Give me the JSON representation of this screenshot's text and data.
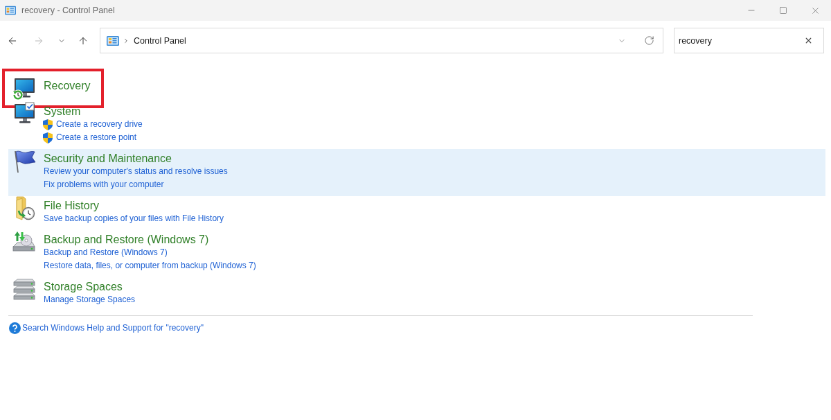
{
  "window": {
    "title": "recovery - Control Panel"
  },
  "nav_buttons": [
    {
      "kind": "back",
      "disabled": false
    },
    {
      "kind": "forward",
      "disabled": true
    },
    {
      "kind": "recent",
      "disabled": false
    },
    {
      "kind": "up",
      "disabled": false
    }
  ],
  "address_bar": {
    "path": [
      "Control Panel"
    ]
  },
  "search": {
    "value": "recovery"
  },
  "results": [
    {
      "title": "Recovery",
      "annotated": true,
      "selected": false
    },
    {
      "title": "System",
      "annotated": false,
      "selected": false,
      "links": [
        {
          "text": "Create a recovery drive",
          "admin": true
        },
        {
          "text": "Create a restore point",
          "admin": true
        }
      ]
    },
    {
      "title": "Security and Maintenance",
      "annotated": false,
      "selected": true,
      "links": [
        {
          "text": "Review your computer's status and resolve issues",
          "admin": false
        },
        {
          "text": "Fix problems with your computer",
          "admin": false
        }
      ]
    },
    {
      "title": "File History",
      "annotated": false,
      "selected": false,
      "links": [
        {
          "text": "Save backup copies of your files with File History",
          "admin": false
        }
      ]
    },
    {
      "title": "Backup and Restore (Windows 7)",
      "annotated": false,
      "selected": false,
      "links": [
        {
          "text": "Backup and Restore (Windows 7)",
          "admin": false
        },
        {
          "text": "Restore data, files, or computer from backup (Windows 7)",
          "admin": false
        }
      ]
    },
    {
      "title": "Storage Spaces",
      "annotated": false,
      "selected": false,
      "links": [
        {
          "text": "Manage Storage Spaces",
          "admin": false
        }
      ]
    }
  ],
  "help_link": {
    "text": "Search Windows Help and Support for \"recovery\""
  }
}
